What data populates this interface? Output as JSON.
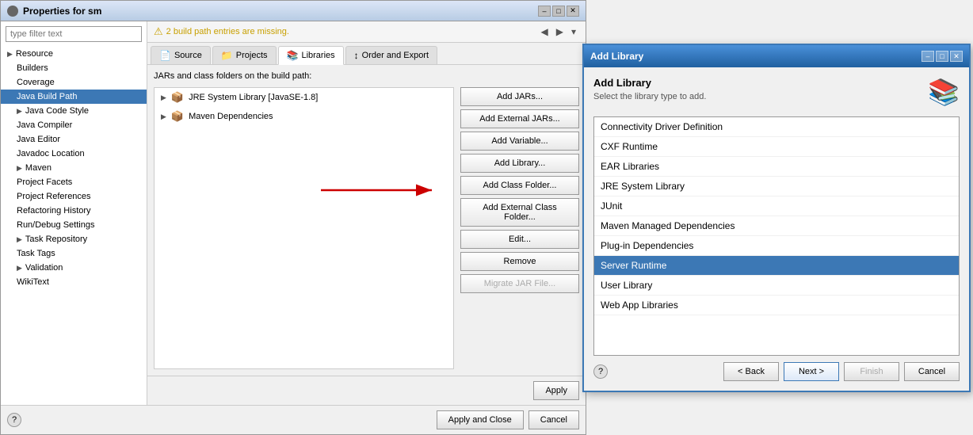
{
  "mainWindow": {
    "title": "Properties for sm",
    "titleControls": [
      "–",
      "□",
      "✕"
    ]
  },
  "topBar": {
    "warningText": "2 build path entries are missing.",
    "warningIcon": "⚠"
  },
  "tabs": [
    {
      "label": "Source",
      "icon": "📄",
      "active": false
    },
    {
      "label": "Projects",
      "icon": "📁",
      "active": false
    },
    {
      "label": "Libraries",
      "icon": "📚",
      "active": true
    },
    {
      "label": "Order and Export",
      "icon": "↕",
      "active": false
    }
  ],
  "contentDesc": "JARs and class folders on the build path:",
  "sidebar": {
    "filterPlaceholder": "type filter text",
    "items": [
      {
        "label": "Resource",
        "expandable": true,
        "indent": 0
      },
      {
        "label": "Builders",
        "expandable": false,
        "indent": 1
      },
      {
        "label": "Coverage",
        "expandable": false,
        "indent": 1
      },
      {
        "label": "Java Build Path",
        "expandable": false,
        "indent": 1,
        "selected": true
      },
      {
        "label": "Java Code Style",
        "expandable": true,
        "indent": 1
      },
      {
        "label": "Java Compiler",
        "expandable": false,
        "indent": 1
      },
      {
        "label": "Java Editor",
        "expandable": false,
        "indent": 1
      },
      {
        "label": "Javadoc Location",
        "expandable": false,
        "indent": 1
      },
      {
        "label": "Maven",
        "expandable": true,
        "indent": 1
      },
      {
        "label": "Project Facets",
        "expandable": false,
        "indent": 1
      },
      {
        "label": "Project References",
        "expandable": false,
        "indent": 1
      },
      {
        "label": "Refactoring History",
        "expandable": false,
        "indent": 1
      },
      {
        "label": "Run/Debug Settings",
        "expandable": false,
        "indent": 1
      },
      {
        "label": "Task Repository",
        "expandable": true,
        "indent": 1
      },
      {
        "label": "Task Tags",
        "expandable": false,
        "indent": 1
      },
      {
        "label": "Validation",
        "expandable": true,
        "indent": 1
      },
      {
        "label": "WikiText",
        "expandable": false,
        "indent": 1
      }
    ]
  },
  "treeItems": [
    {
      "label": "JRE System Library [JavaSE-1.8]",
      "icon": "📦",
      "expandable": true
    },
    {
      "label": "Maven Dependencies",
      "icon": "📦",
      "expandable": true
    }
  ],
  "actionButtons": [
    {
      "label": "Add JARs...",
      "disabled": false
    },
    {
      "label": "Add External JARs...",
      "disabled": false
    },
    {
      "label": "Add Variable...",
      "disabled": false
    },
    {
      "label": "Add Library...",
      "disabled": false,
      "highlighted": true
    },
    {
      "label": "Add Class Folder...",
      "disabled": false
    },
    {
      "label": "Add External Class Folder...",
      "disabled": false
    },
    {
      "label": "Edit...",
      "disabled": false
    },
    {
      "label": "Remove",
      "disabled": false
    },
    {
      "label": "Migrate JAR File...",
      "disabled": true
    }
  ],
  "bottomButtons": {
    "applyClose": "Apply and Close",
    "cancel": "Cancel",
    "apply": "Apply"
  },
  "addLibraryDialog": {
    "title": "Add Library",
    "heading": "Add Library",
    "subtitle": "Select the library type to add.",
    "icon": "📚",
    "libraries": [
      {
        "label": "Connectivity Driver Definition",
        "selected": false
      },
      {
        "label": "CXF Runtime",
        "selected": false
      },
      {
        "label": "EAR Libraries",
        "selected": false
      },
      {
        "label": "JRE System Library",
        "selected": false
      },
      {
        "label": "JUnit",
        "selected": false
      },
      {
        "label": "Maven Managed Dependencies",
        "selected": false
      },
      {
        "label": "Plug-in Dependencies",
        "selected": false
      },
      {
        "label": "Server Runtime",
        "selected": true
      },
      {
        "label": "User Library",
        "selected": false
      },
      {
        "label": "Web App Libraries",
        "selected": false
      }
    ],
    "buttons": {
      "back": "< Back",
      "next": "Next >",
      "finish": "Finish",
      "cancel": "Cancel"
    }
  }
}
